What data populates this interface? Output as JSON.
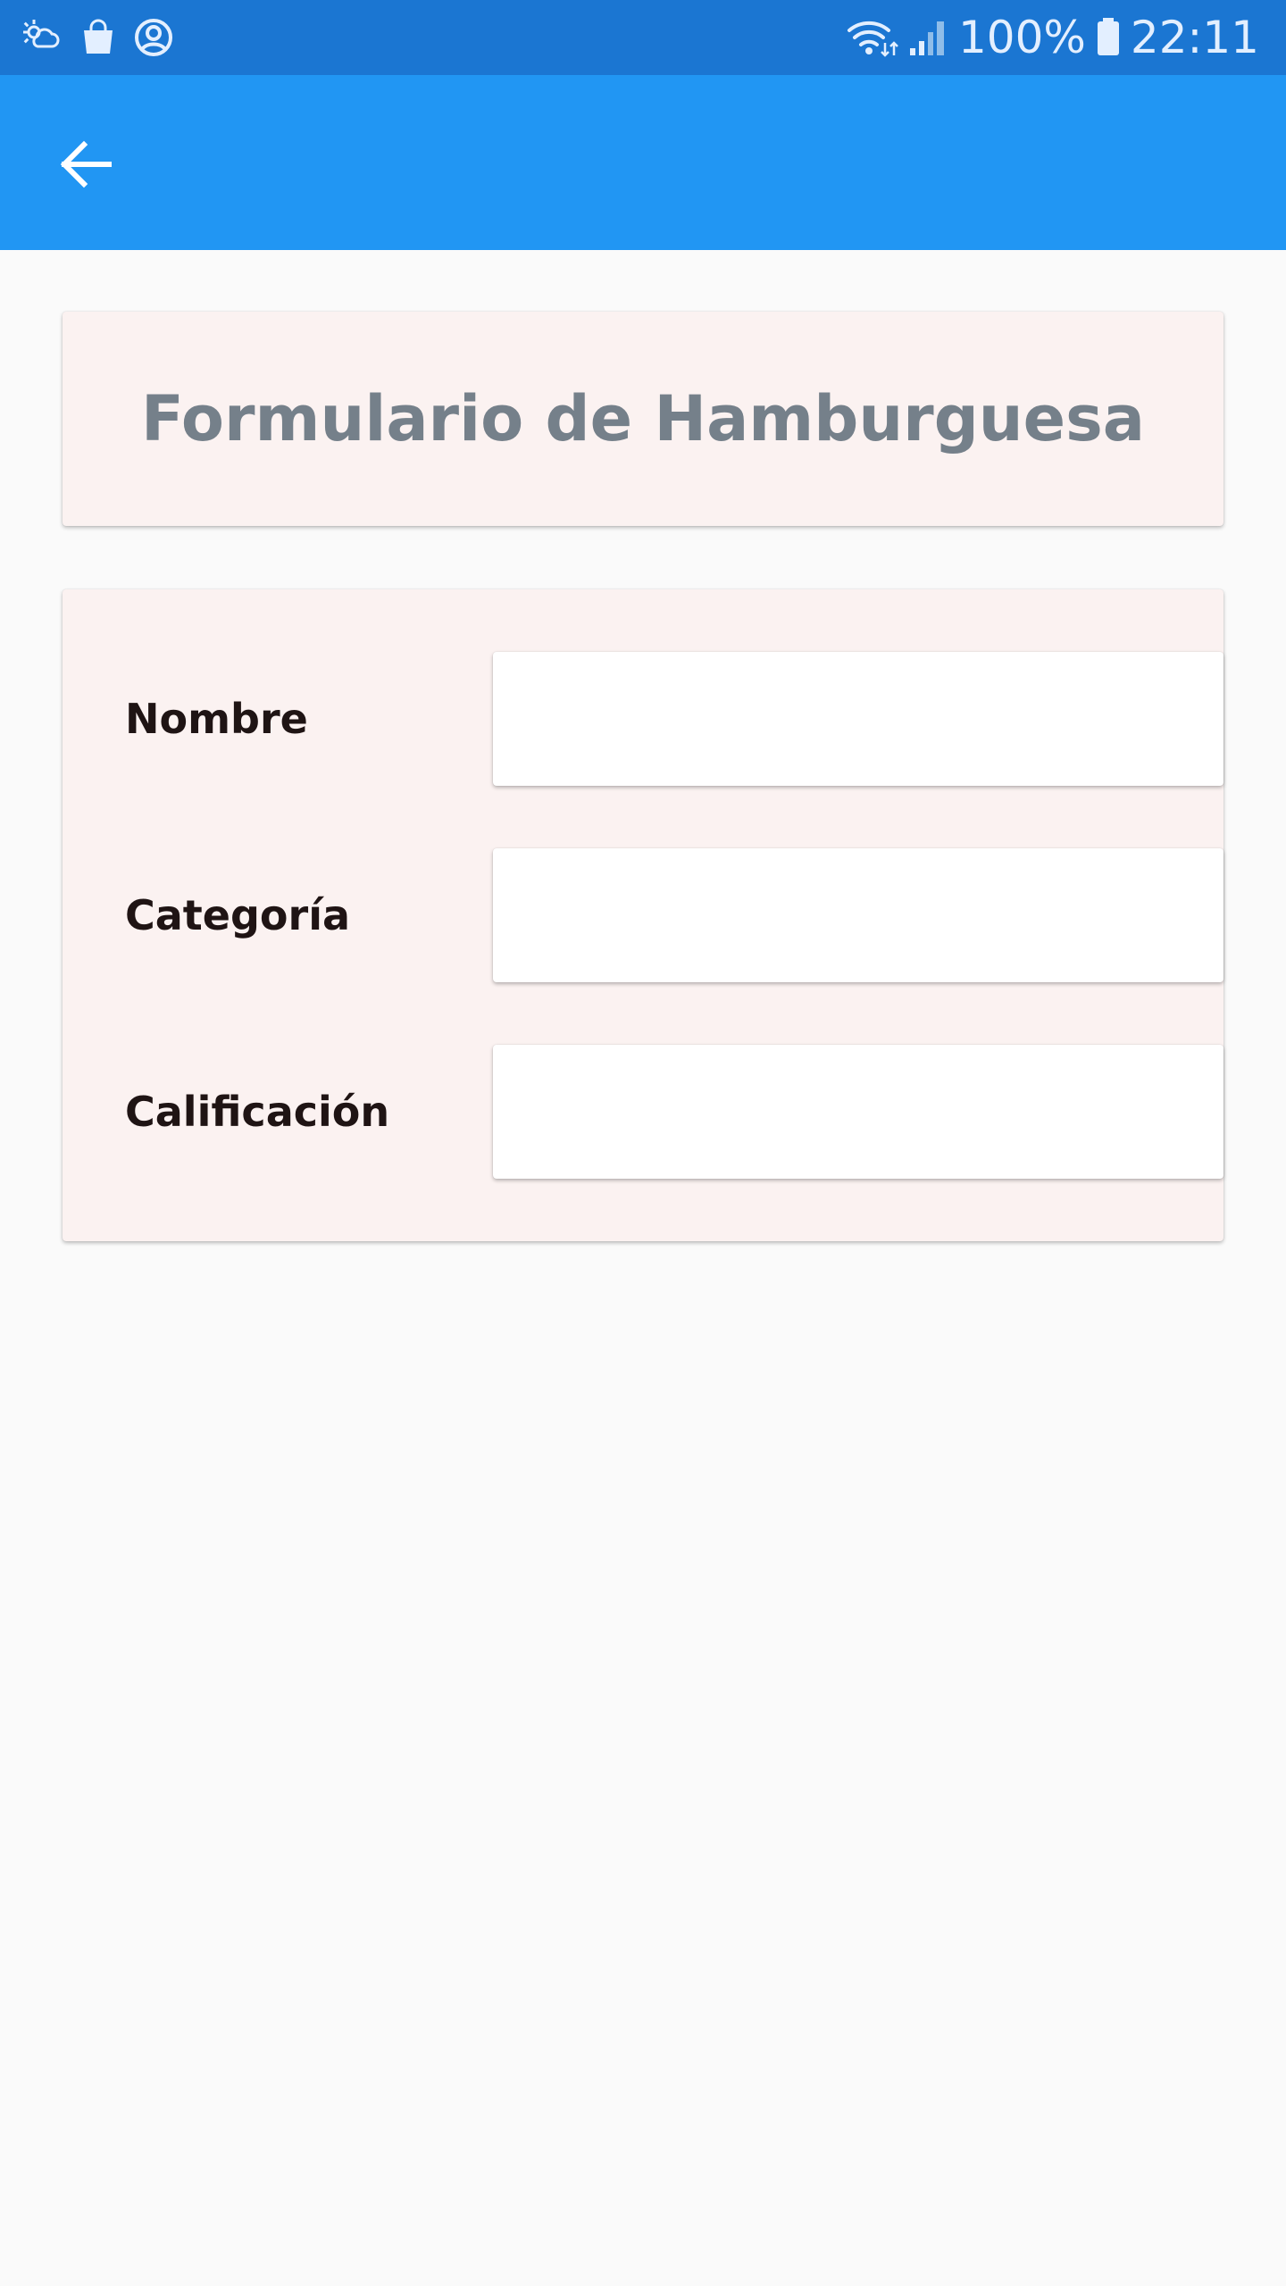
{
  "status_bar": {
    "left_icons": [
      "weather-icon",
      "shopping-bag-icon",
      "account-circle-icon"
    ],
    "right_icons": [
      "wifi-icon",
      "cell-signal-icon",
      "battery-icon"
    ],
    "battery_text": "100%",
    "time": "22:11",
    "background": "#1b76d2"
  },
  "app_bar": {
    "background": "#2196f3",
    "back_icon": "arrow-back-icon"
  },
  "title_card": {
    "title": "Formulario de Hamburguesa"
  },
  "form": {
    "fields": [
      {
        "label": "Nombre",
        "value": "",
        "placeholder": ""
      },
      {
        "label": "Categoría",
        "value": "",
        "placeholder": ""
      },
      {
        "label": "Calificación",
        "value": "",
        "placeholder": ""
      }
    ]
  }
}
